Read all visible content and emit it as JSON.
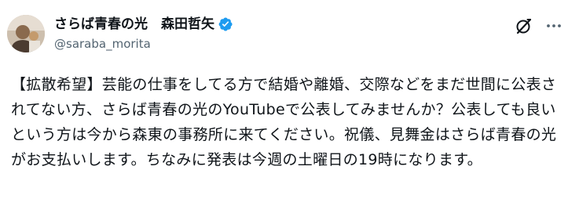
{
  "author": {
    "display_name": "さらば青春の光　森田哲矢",
    "handle": "@saraba_morita",
    "verified": true
  },
  "actions": {
    "grok_icon": "grok-icon",
    "more_icon": "more-icon"
  },
  "post": {
    "text": "【拡散希望】芸能の仕事をしてる方で結婚や離婚、交際などをまだ世間に公表されてない方、さらば青春の光のYouTubeで公表してみませんか？公表しても良いという方は今から森東の事務所に来てください。祝儀、見舞金はさらば青春の光がお支払いします。ちなみに発表は今週の土曜日の19時になります。"
  },
  "colors": {
    "verified_badge": "#1d9bf0",
    "text_primary": "#0f1419",
    "text_secondary": "#536471"
  }
}
